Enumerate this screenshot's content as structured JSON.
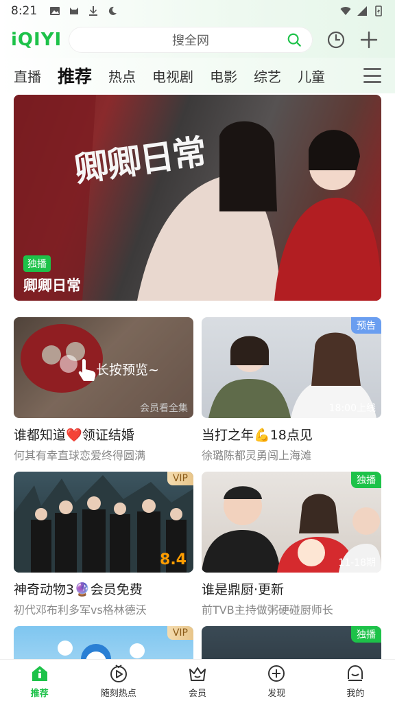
{
  "status": {
    "time": "8:21",
    "left_icons": [
      "image-icon",
      "cat-icon",
      "download-icon",
      "moon-icon"
    ],
    "right_icons": [
      "wifi-icon",
      "signal-icon",
      "battery-icon"
    ]
  },
  "header": {
    "logo": "iQIYI",
    "search_placeholder": "搜全网",
    "icons": [
      "search-icon",
      "history-clock-icon",
      "add-plus-icon"
    ]
  },
  "tabs": [
    {
      "label": "直播",
      "active": false
    },
    {
      "label": "推荐",
      "active": true
    },
    {
      "label": "热点",
      "active": false
    },
    {
      "label": "电视剧",
      "active": false
    },
    {
      "label": "电影",
      "active": false
    },
    {
      "label": "综艺",
      "active": false
    },
    {
      "label": "儿童",
      "active": false
    }
  ],
  "hero": {
    "calligraphy": "卿卿日常",
    "badge": "独播",
    "title": "卿卿日常"
  },
  "cards": [
    {
      "title_before": "谁都知道",
      "title_emoji": "❤️",
      "title_after": "领证结婚",
      "subtitle": "何其有幸直球恋爱终得圆满",
      "preview_text": "长按预览~",
      "corner_text": "会员看全集"
    },
    {
      "title_before": "当打之年",
      "title_emoji": "💪",
      "title_after": "18点见",
      "subtitle": "徐璐陈都灵勇闯上海滩",
      "tag": "预告",
      "corner_text": "18:00上线"
    },
    {
      "title_before": "神奇动物3",
      "title_emoji": "🔮",
      "title_after": "会员免费",
      "subtitle": "初代邓布利多军vs格林德沃",
      "tag": "VIP",
      "score": "8.4"
    },
    {
      "title_before": "谁是鼎厨·更新",
      "title_emoji": "",
      "title_after": "",
      "subtitle": "前TVB主持做粥硬碰厨师长",
      "tag": "独播",
      "corner_text": "11-18期"
    },
    {
      "tag": "VIP"
    },
    {
      "tag": "独播"
    }
  ],
  "bottom_nav": [
    {
      "label": "推荐",
      "icon": "home-icon",
      "active": true
    },
    {
      "label": "随刻热点",
      "icon": "play-circle-icon",
      "active": false
    },
    {
      "label": "会员",
      "icon": "crown-icon",
      "active": false
    },
    {
      "label": "发现",
      "icon": "discover-plus-icon",
      "active": false
    },
    {
      "label": "我的",
      "icon": "profile-icon",
      "active": false
    }
  ],
  "colors": {
    "brand_green": "#1dc249",
    "vip_gold": "#e8c58a",
    "preview_blue": "#6a9ef0",
    "score_orange": "#ff9d00"
  }
}
